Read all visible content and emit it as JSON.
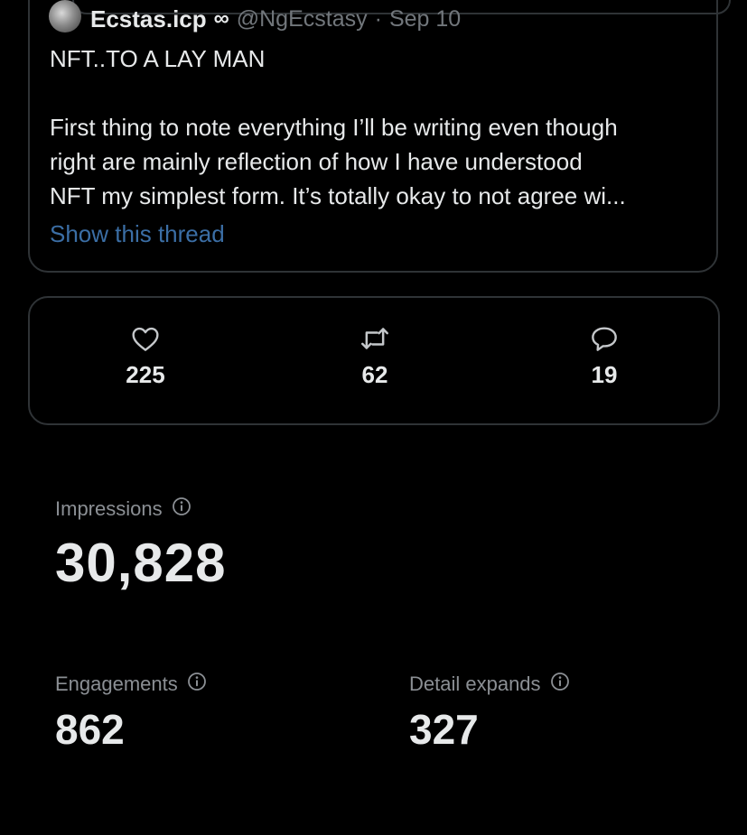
{
  "tweet": {
    "author_name": "Ecstas.icp",
    "author_badge": "∞",
    "handle": "@NgEcstasy",
    "separator": "·",
    "date": "Sep 10",
    "title": "NFT..TO A LAY MAN",
    "body_lines": [
      "First thing to note everything I’ll be writing even though",
      "right are mainly reflection of how I have understood",
      "NFT my simplest form. It’s totally okay to not agree wi..."
    ],
    "show_thread_label": "Show this thread"
  },
  "stats": {
    "likes": "225",
    "retweets": "62",
    "replies": "19"
  },
  "metrics": {
    "impressions": {
      "label": "Impressions",
      "value": "30,828"
    },
    "engagements": {
      "label": "Engagements",
      "value": "862"
    },
    "detail_expands": {
      "label": "Detail expands",
      "value": "327"
    }
  },
  "colors": {
    "background": "#000000",
    "border": "#2f3336",
    "text_primary": "#e7e9ea",
    "text_secondary": "#71767b",
    "link": "#3b6ea5"
  }
}
